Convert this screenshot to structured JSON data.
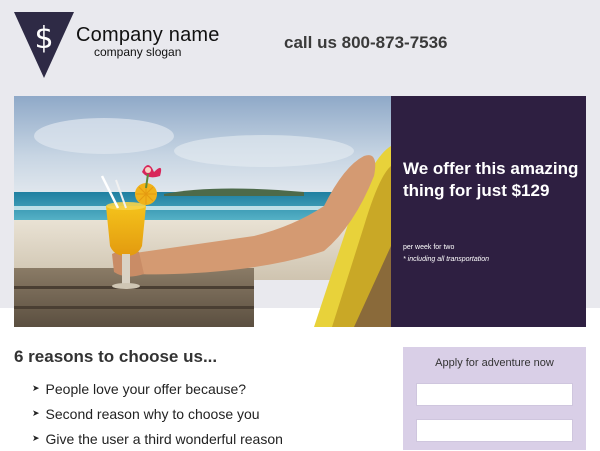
{
  "header": {
    "logo_icon": "dollar-pennant-icon",
    "logo_symbol": "$",
    "company_name": "Company name",
    "company_slogan": "company slogan",
    "call_us": "call us 800-873-7536"
  },
  "hero": {
    "image_description_icon": "beach-cocktail-photo",
    "offer_title": "We offer this amazing thing for just $129",
    "offer_sub": "per week for two",
    "offer_note": "* including all transportation"
  },
  "reasons": {
    "title": "6 reasons to choose us...",
    "items": [
      {
        "icon": "arrow-right-icon",
        "text": "People love your offer because?"
      },
      {
        "icon": "arrow-right-icon",
        "text": "Second reason why to choose you"
      },
      {
        "icon": "arrow-right-icon",
        "text": "Give the user a third wonderful reason"
      }
    ]
  },
  "form": {
    "title": "Apply for adventure now",
    "field1_value": "",
    "field2_value": ""
  },
  "colors": {
    "header_bg": "#e9e9ee",
    "panel_bg": "#2e1f41",
    "form_bg": "#d9cfe7",
    "logo": "#2e2a45"
  }
}
